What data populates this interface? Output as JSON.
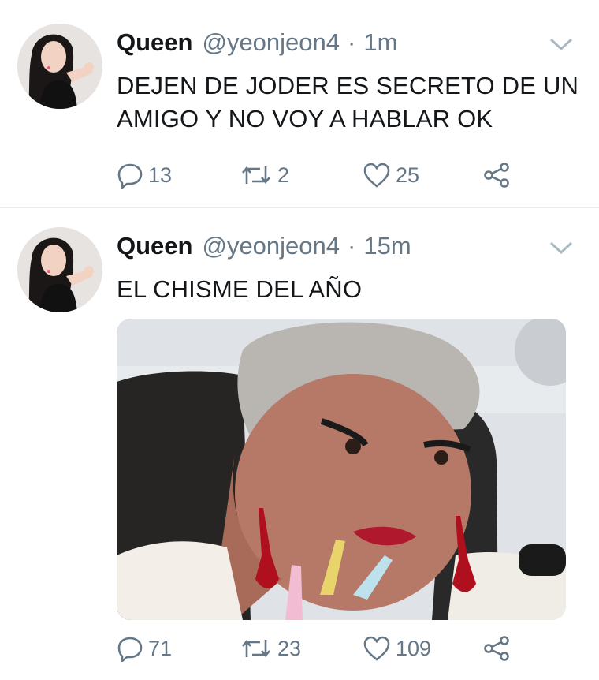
{
  "tweets": [
    {
      "author_name": "Queen",
      "handle": "@yeonjeon4",
      "separator": "·",
      "time": "1m",
      "text_lines": [
        "DEJEN DE JODER ES SECRETO DE UN",
        "AMIGO Y NO VOY A HABLAR OK"
      ],
      "replies": "13",
      "retweets": "2",
      "likes": "25"
    },
    {
      "author_name": "Queen",
      "handle": "@yeonjeon4",
      "separator": "·",
      "time": "15m",
      "text_lines": [
        "EL CHISME DEL AÑO"
      ],
      "replies": "71",
      "retweets": "23",
      "likes": "109"
    }
  ],
  "icons": {
    "reply": "reply-icon",
    "retweet": "retweet-icon",
    "like": "heart-icon",
    "share": "share-icon",
    "menu": "chevron-down-icon"
  },
  "colors": {
    "text": "#14171a",
    "secondary": "#657786",
    "divider": "#e6ecf0"
  }
}
